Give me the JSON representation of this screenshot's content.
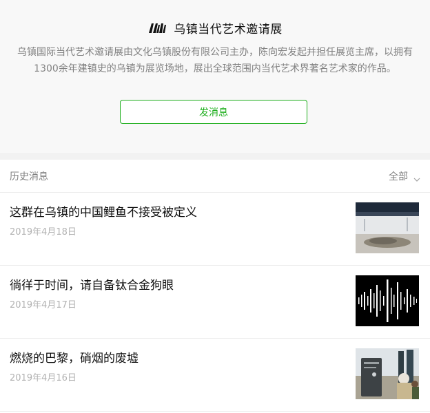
{
  "profile": {
    "title": "乌镇当代艺术邀请展",
    "description": "乌镇国际当代艺术邀请展由文化乌镇股份有限公司主办，陈向宏发起并担任展览主席，以拥有1300余年建镇史的乌镇为展览场地，展出全球范围内当代艺术界著名艺术家的作品。",
    "send_label": "发消息"
  },
  "history": {
    "label": "历史消息",
    "filter_label": "全部",
    "articles": [
      {
        "title": "这群在乌镇的中国鲤鱼不接受被定义",
        "date": "2019年4月18日"
      },
      {
        "title": "徜徉于时间，请自备钛合金狗眼",
        "date": "2019年4月17日"
      },
      {
        "title": "燃烧的巴黎，硝烟的废墟",
        "date": "2019年4月16日"
      }
    ]
  },
  "colors": {
    "accent": "#1aad19",
    "muted_text": "#808080",
    "date_text": "#b2b2b2"
  }
}
